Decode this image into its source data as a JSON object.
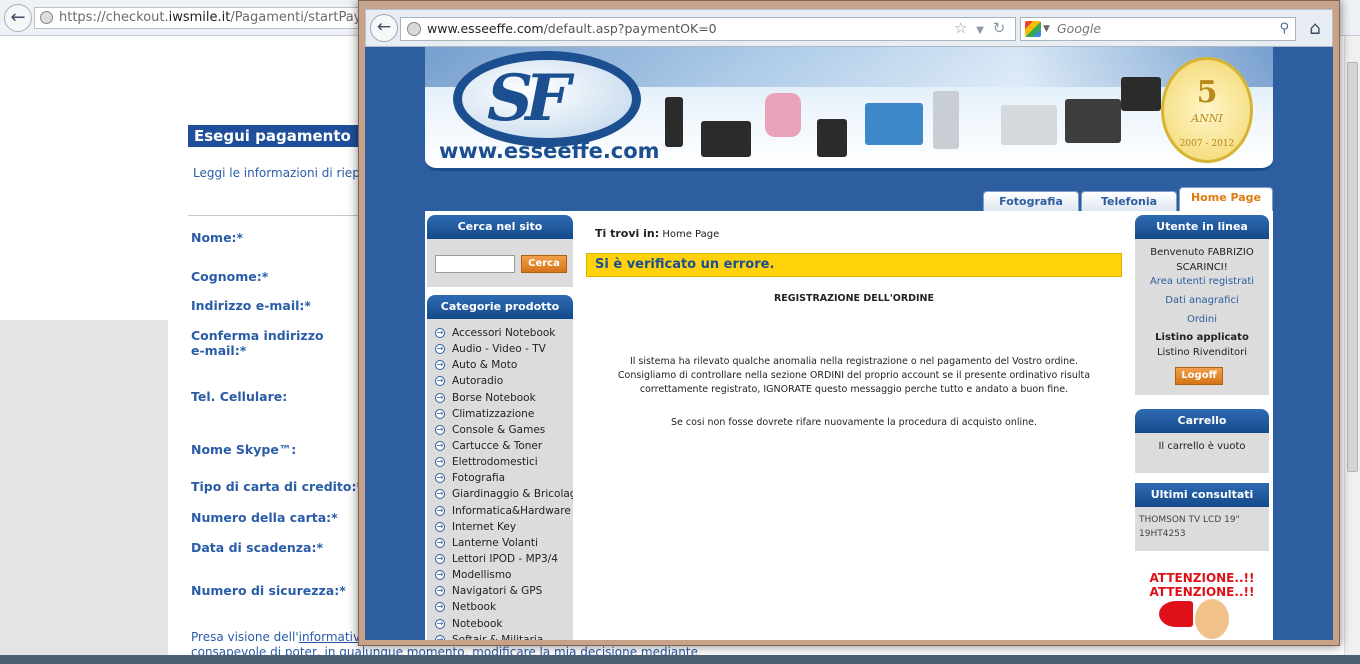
{
  "background_window": {
    "url_scheme": "https://checkout.",
    "url_domain": "iwsmile.it",
    "url_path": "/Pagamenti/startPayment.do",
    "form_title": "Esegui pagamento",
    "intro_text": "Leggi le informazioni di riepil",
    "labels": [
      "Nome:*",
      "Cognome:*",
      "Indirizzo e-mail:*",
      "Conferma indirizzo",
      "e-mail:*",
      "Tel. Cellulare:",
      "Nome Skype™:",
      "Tipo di carta di credito:*",
      "Numero della carta:*",
      "Data di scadenza:*",
      "Numero di sicurezza:*"
    ],
    "footer_line1_prefix": "Presa visione dell'",
    "footer_line1_link": "informative",
    "footer_line2": "consapevole di poter, in qualunque momento, modificare la mia decisione mediante"
  },
  "foreground_window": {
    "url_domain": "www.esseeffe.com",
    "url_path": "/default.asp?paymentOK=0",
    "search_placeholder": "Google",
    "banner_site_name": "www.esseeffe.com",
    "badge_number": "5",
    "badge_word": "ANNI",
    "badge_years": "2007 - 2012",
    "tabs": [
      "Fotografia",
      "Telefonia",
      "Home Page"
    ],
    "left_sidebar": {
      "search_title": "Cerca nel sito",
      "search_button": "Cerca",
      "categories_title": "Categorie prodotto",
      "categories": [
        "Accessori Notebook",
        "Audio - Video - TV",
        "Auto & Moto",
        "Autoradio",
        "Borse Notebook",
        "Climatizzazione",
        "Console & Games",
        "Cartucce & Toner",
        "Elettrodomestici",
        "Fotografia",
        "Giardinaggio & Bricolage",
        "Informatica&Hardware",
        "Internet Key",
        "Lanterne Volanti",
        "Lettori IPOD - MP3/4",
        "Modellismo",
        "Navigatori & GPS",
        "Netbook",
        "Notebook",
        "Softair & Militaria"
      ]
    },
    "center": {
      "breadcrumb_label": "Ti trovi in:",
      "breadcrumb_value": "Home Page",
      "error_text": "Si è verificato un errore.",
      "reg_title": "REGISTRAZIONE DELL'ORDINE",
      "message_lines": [
        "Il sistema ha rilevato qualche anomalia nella registrazione o nel pagamento del Vostro ordine.",
        "Consigliamo di controllare nella sezione ORDINI del proprio account se il presente ordinativo risulta",
        "correttamente registrato, IGNORATE questo messaggio perche tutto e andato a buon fine."
      ],
      "retry_text": "Se cosi non fosse dovrete rifare nuovamente la procedura di acquisto online."
    },
    "right_sidebar": {
      "user_title": "Utente in linea",
      "welcome_line1": "Benvenuto FABRIZIO",
      "welcome_line2": "SCARINCI!",
      "link_area": "Area utenti registrati",
      "link_dati": "Dati anagrafici",
      "link_ordini": "Ordini",
      "listino_label": "Listino applicato",
      "listino_value": "Listino Rivenditori",
      "logoff_button": "Logoff",
      "cart_title": "Carrello",
      "cart_text": "Il carrello è vuoto",
      "recent_title": "Ultimi consultati",
      "recent_line1": "THOMSON TV LCD 19\"",
      "recent_line2": "19HT4253",
      "alert_line1": "ATTENZIONE..!!",
      "alert_line2": "ATTENZIONE..!!"
    }
  }
}
